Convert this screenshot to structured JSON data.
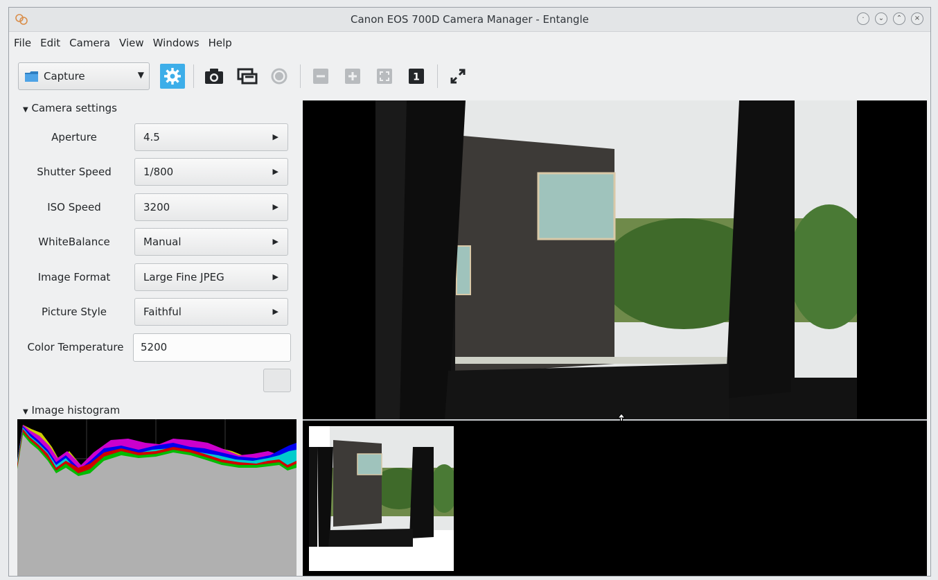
{
  "window": {
    "title": "Canon EOS 700D Camera Manager - Entangle",
    "controls": [
      "·",
      "⌄",
      "⌃",
      "×"
    ]
  },
  "menu": [
    "File",
    "Edit",
    "Camera",
    "View",
    "Windows",
    "Help"
  ],
  "toolbar": {
    "mode": "Capture",
    "accent_color": "#3daee9",
    "icons": [
      "settings-gear-icon",
      "camera-icon",
      "preview-icon",
      "record-icon",
      "zoom-out-icon",
      "zoom-in-icon",
      "zoom-fit-icon",
      "zoom-1to1-icon",
      "fullscreen-icon"
    ],
    "zoom_normal_label": "1"
  },
  "camera_settings": {
    "header": "Camera settings",
    "rows": [
      {
        "label": "Aperture",
        "value": "4.5"
      },
      {
        "label": "Shutter Speed",
        "value": "1/800"
      },
      {
        "label": "ISO Speed",
        "value": "3200"
      },
      {
        "label": "WhiteBalance",
        "value": "Manual"
      },
      {
        "label": "Image Format",
        "value": "Large Fine JPEG"
      },
      {
        "label": "Picture Style",
        "value": "Faithful"
      }
    ],
    "color_temperature_label": "Color Temperature",
    "color_temperature_value": "5200"
  },
  "histogram": {
    "header": "Image histogram",
    "channel_colors": [
      "#ff0000",
      "#00cc00",
      "#0000ff",
      "#00cccc",
      "#cc00cc",
      "#cccc00",
      "#b0b0b0"
    ]
  },
  "filmstrip": {
    "thumbnails": 1
  }
}
